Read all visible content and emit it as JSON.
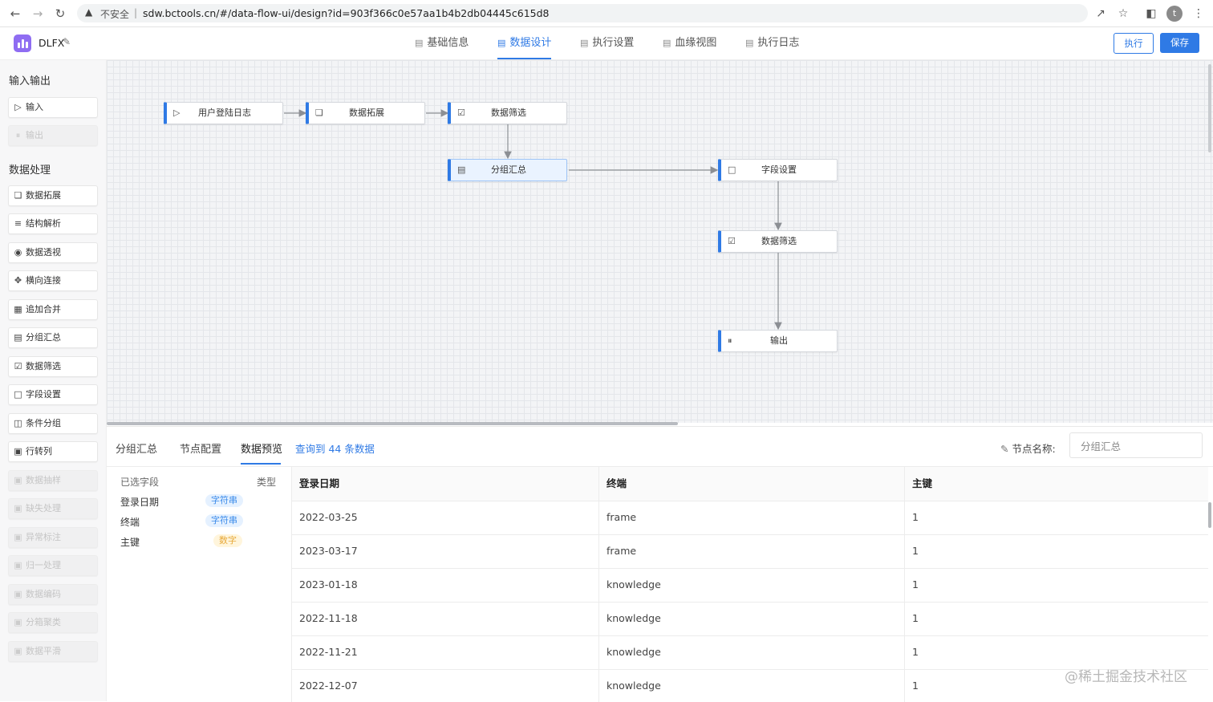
{
  "browser": {
    "security_label": "不安全",
    "url": "sdw.bctools.cn/#/data-flow-ui/design?id=903f366c0e57aa1b4b2db04445c615d8",
    "profile_initial": "t"
  },
  "app": {
    "title": "DLFX",
    "tabs": [
      {
        "label": "基础信息"
      },
      {
        "label": "数据设计"
      },
      {
        "label": "执行设置"
      },
      {
        "label": "血缘视图"
      },
      {
        "label": "执行日志"
      }
    ],
    "active_tab": "数据设计",
    "run_label": "执行",
    "save_label": "保存",
    "accent_color": "#2f7ae5"
  },
  "sidebar": {
    "sections": [
      {
        "title": "输入输出",
        "items": [
          {
            "label": "输入",
            "icon": "play-circle-icon",
            "disabled": false
          },
          {
            "label": "输出",
            "icon": "pause-circle-icon",
            "disabled": true
          }
        ]
      },
      {
        "title": "数据处理",
        "items": [
          {
            "label": "数据拓展",
            "icon": "copy-icon",
            "disabled": false
          },
          {
            "label": "结构解析",
            "icon": "sliders-icon",
            "disabled": false
          },
          {
            "label": "数据透视",
            "icon": "eye-icon",
            "disabled": false
          },
          {
            "label": "横向连接",
            "icon": "move-icon",
            "disabled": false
          },
          {
            "label": "追加合并",
            "icon": "calendar-icon",
            "disabled": false
          },
          {
            "label": "分组汇总",
            "icon": "file-list-icon",
            "disabled": false
          },
          {
            "label": "数据筛选",
            "icon": "file-check-icon",
            "disabled": false
          },
          {
            "label": "字段设置",
            "icon": "file-icon",
            "disabled": false
          },
          {
            "label": "条件分组",
            "icon": "columns-icon",
            "disabled": false
          },
          {
            "label": "行转列",
            "icon": "box-icon",
            "disabled": false
          },
          {
            "label": "数据抽样",
            "icon": "box-icon",
            "disabled": true
          },
          {
            "label": "缺失处理",
            "icon": "box-icon",
            "disabled": true
          },
          {
            "label": "异常标注",
            "icon": "box-icon",
            "disabled": true
          },
          {
            "label": "归一处理",
            "icon": "box-icon",
            "disabled": true
          },
          {
            "label": "数据编码",
            "icon": "box-icon",
            "disabled": true
          },
          {
            "label": "分箱聚类",
            "icon": "box-icon",
            "disabled": true
          },
          {
            "label": "数据平滑",
            "icon": "box-icon",
            "disabled": true
          }
        ]
      }
    ]
  },
  "flow": {
    "nodes": [
      {
        "id": "n1",
        "label": "用户登陆日志",
        "icon": "play-circle-icon"
      },
      {
        "id": "n2",
        "label": "数据拓展",
        "icon": "copy-icon"
      },
      {
        "id": "n3",
        "label": "数据筛选",
        "icon": "file-check-icon"
      },
      {
        "id": "n4",
        "label": "分组汇总",
        "icon": "file-list-icon",
        "selected": true
      },
      {
        "id": "n5",
        "label": "字段设置",
        "icon": "file-icon"
      },
      {
        "id": "n6",
        "label": "数据筛选",
        "icon": "file-check-icon"
      },
      {
        "id": "n7",
        "label": "输出",
        "icon": "pause-circle-icon"
      }
    ],
    "edges": [
      [
        "n1",
        "n2"
      ],
      [
        "n2",
        "n3"
      ],
      [
        "n3",
        "n4"
      ],
      [
        "n4",
        "n5"
      ],
      [
        "n5",
        "n6"
      ],
      [
        "n6",
        "n7"
      ]
    ]
  },
  "panel": {
    "tabs": [
      {
        "label": "分组汇总"
      },
      {
        "label": "节点配置"
      },
      {
        "label": "数据预览"
      }
    ],
    "active_tab": "数据预览",
    "query_count": "查询到 44 条数据",
    "node_name_label": "节点名称:",
    "node_name_value": "分组汇总",
    "fields_header": {
      "name": "已选字段",
      "type": "类型"
    },
    "fields": [
      {
        "name": "登录日期",
        "type": "字符串",
        "kind": "string"
      },
      {
        "name": "终端",
        "type": "字符串",
        "kind": "string"
      },
      {
        "name": "主键",
        "type": "数字",
        "kind": "number"
      }
    ],
    "table": {
      "columns": [
        "登录日期",
        "终端",
        "主键"
      ],
      "rows": [
        [
          "2022-03-25",
          "frame",
          "1"
        ],
        [
          "2023-03-17",
          "frame",
          "1"
        ],
        [
          "2023-01-18",
          "knowledge",
          "1"
        ],
        [
          "2022-11-18",
          "knowledge",
          "1"
        ],
        [
          "2022-11-21",
          "knowledge",
          "1"
        ],
        [
          "2022-12-07",
          "knowledge",
          "1"
        ]
      ]
    }
  },
  "watermark": "@稀土掘金技术社区"
}
